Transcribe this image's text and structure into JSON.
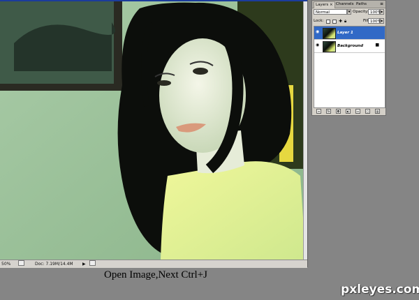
{
  "document": {
    "status_zoom": "50%",
    "status_doc": "Doc: 7.19M/14.4M"
  },
  "layers_panel": {
    "tabs": [
      {
        "label": "Layers",
        "close": "×"
      },
      {
        "label": "Channels"
      },
      {
        "label": "Paths"
      }
    ],
    "blend_mode": "Normal",
    "opacity_label": "Opacity:",
    "opacity_value": "100%",
    "lock_label": "Lock:",
    "fill_label": "Fill:",
    "fill_value": "100%",
    "layers": [
      {
        "name": "Layer 1",
        "selected": true
      },
      {
        "name": "Background",
        "selected": false,
        "locked": true
      }
    ],
    "bottom_icons": [
      "link-icon",
      "fx-icon",
      "mask-icon",
      "adjustment-icon",
      "group-icon",
      "new-layer-icon",
      "trash-icon"
    ]
  },
  "caption": "Open Image,Next Ctrl+J",
  "watermark": "pxleyes.com",
  "colors": {
    "selection": "#3169c6",
    "background": "#858585"
  }
}
